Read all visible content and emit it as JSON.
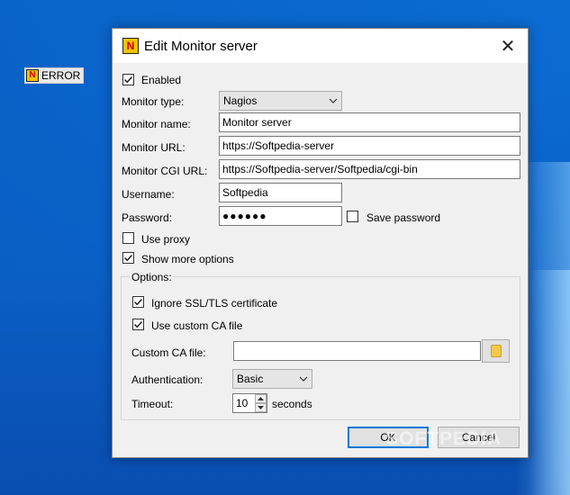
{
  "desktop": {
    "tray_label": "ERROR",
    "watermark": "SOFTPEDIA"
  },
  "dialog": {
    "title": "Edit Monitor server",
    "close_glyph": "✕",
    "enabled_label": "Enabled",
    "enabled_checked": true,
    "monitor_type_label": "Monitor type:",
    "monitor_type_value": "Nagios",
    "monitor_name_label": "Monitor name:",
    "monitor_name_value": "Monitor server",
    "monitor_url_label": "Monitor URL:",
    "monitor_url_value": "https://Softpedia-server",
    "monitor_cgi_url_label": "Monitor CGI URL:",
    "monitor_cgi_url_value": "https://Softpedia-server/Softpedia/cgi-bin",
    "username_label": "Username:",
    "username_value": "Softpedia",
    "password_label": "Password:",
    "password_value": "●●●●●●",
    "save_password_label": "Save password",
    "save_password_checked": false,
    "use_proxy_label": "Use proxy",
    "use_proxy_checked": false,
    "show_more_options_label": "Show more options",
    "show_more_options_checked": true,
    "options": {
      "group_label": "Options:",
      "ignore_ssl_label": "Ignore SSL/TLS certificate",
      "ignore_ssl_checked": true,
      "use_custom_ca_label": "Use custom CA file",
      "use_custom_ca_checked": true,
      "custom_ca_file_label": "Custom CA file:",
      "custom_ca_file_value": "",
      "authentication_label": "Authentication:",
      "authentication_value": "Basic",
      "timeout_label": "Timeout:",
      "timeout_value": "10",
      "timeout_unit": "seconds"
    },
    "ok_label": "OK",
    "cancel_label": "Cancel"
  },
  "icons": {
    "app_icon_glyph": "N",
    "check": "checkmark-icon",
    "dropdown": "chevron-down-icon",
    "folder": "folder-icon"
  },
  "colors": {
    "desktop_blue": "#0a64c8",
    "dialog_bg": "#f0f0f0",
    "focus_border": "#0078d7"
  }
}
